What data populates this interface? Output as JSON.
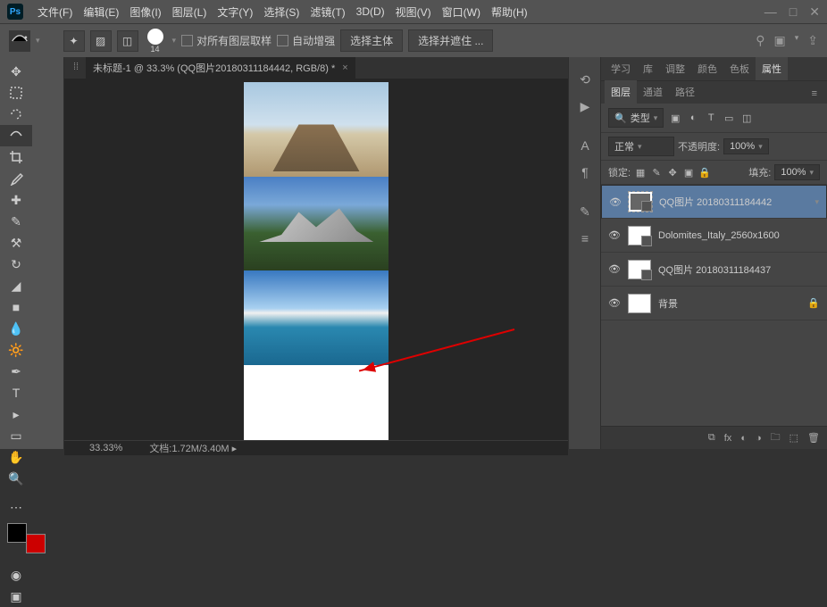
{
  "app": {
    "logo": "Ps"
  },
  "menu": {
    "file": "文件(F)",
    "edit": "编辑(E)",
    "image": "图像(I)",
    "layer": "图层(L)",
    "text": "文字(Y)",
    "select": "选择(S)",
    "filter": "滤镜(T)",
    "threed": "3D(D)",
    "view": "视图(V)",
    "window": "窗口(W)",
    "help": "帮助(H)"
  },
  "toolbar": {
    "brush_num": "14",
    "cb1": "对所有图层取样",
    "cb2": "自动增强",
    "btn1": "选择主体",
    "btn2": "选择并遮住 ..."
  },
  "tab": {
    "title": "未标题-1 @ 33.3% (QQ图片20180311184442, RGB/8) *"
  },
  "status": {
    "zoom": "33.33%",
    "doc_label": "文档:",
    "doc": "1.72M/3.40M"
  },
  "panels": {
    "top": {
      "study": "学习",
      "lib": "库",
      "adjust": "调整",
      "color": "颜色",
      "swatch": "色板",
      "props": "属性"
    },
    "mid": {
      "layers": "图层",
      "channels": "通道",
      "paths": "路径"
    },
    "filter": {
      "kind": "类型"
    },
    "blend": {
      "mode": "正常",
      "op_label": "不透明度:",
      "op_val": "100%"
    },
    "lock": {
      "label": "锁定:",
      "fill_label": "填充:",
      "fill_val": "100%"
    }
  },
  "layers": [
    {
      "name": "QQ图片 20180311184442",
      "selected": true,
      "smart": true
    },
    {
      "name": "Dolomites_Italy_2560x1600",
      "selected": false,
      "smart": true
    },
    {
      "name": "QQ图片 20180311184437",
      "selected": false,
      "smart": true
    },
    {
      "name": "背景",
      "selected": false,
      "locked": true
    }
  ]
}
